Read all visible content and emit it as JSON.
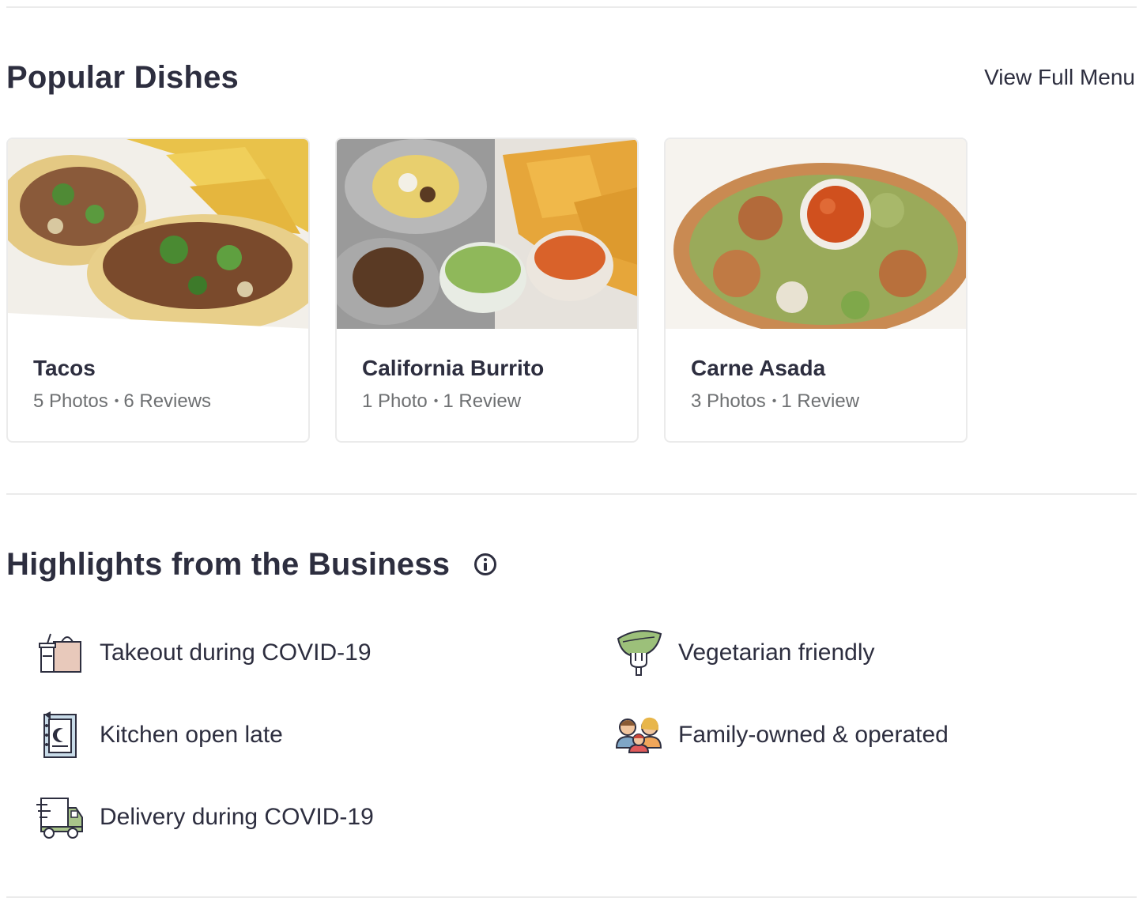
{
  "popular_dishes": {
    "title": "Popular Dishes",
    "view_full_menu": "View Full Menu",
    "dishes": [
      {
        "name": "Tacos",
        "photos": "5 Photos",
        "reviews": "6 Reviews"
      },
      {
        "name": "California Burrito",
        "photos": "1 Photo",
        "reviews": "1 Review"
      },
      {
        "name": "Carne Asada",
        "photos": "3 Photos",
        "reviews": "1 Review"
      }
    ]
  },
  "highlights": {
    "title": "Highlights from the Business",
    "info_icon": "info-icon",
    "items": [
      {
        "label": "Takeout during COVID-19",
        "icon": "takeout-bag-icon"
      },
      {
        "label": "Vegetarian friendly",
        "icon": "leaf-fork-icon"
      },
      {
        "label": "Kitchen open late",
        "icon": "moon-menu-icon"
      },
      {
        "label": "Family-owned & operated",
        "icon": "family-icon"
      },
      {
        "label": "Delivery during COVID-19",
        "icon": "delivery-truck-icon"
      }
    ]
  },
  "colors": {
    "text": "#2d2e3f",
    "meta": "#6e7072",
    "divider": "#ebebeb"
  }
}
